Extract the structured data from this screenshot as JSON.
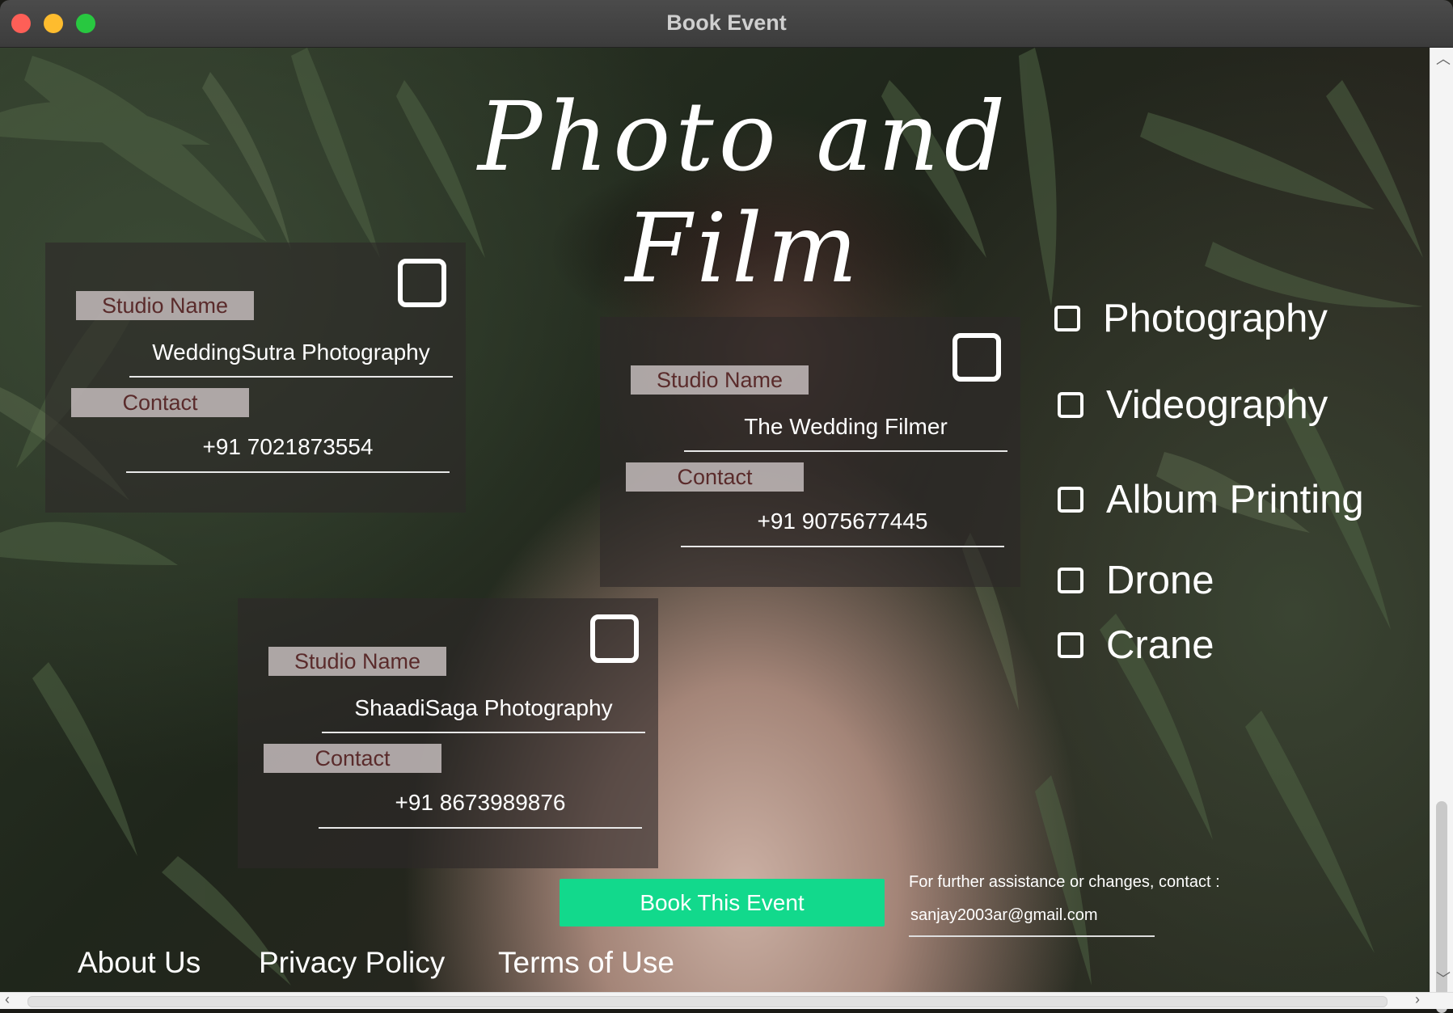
{
  "window": {
    "title": "Book Event"
  },
  "hero": {
    "title": "Photo and Film"
  },
  "studios": [
    {
      "studio_label": "Studio Name",
      "studio_name": "WeddingSutra Photography",
      "contact_label": "Contact",
      "contact": "+91  7021873554",
      "selected": false
    },
    {
      "studio_label": "Studio Name",
      "studio_name": "The Wedding Filmer",
      "contact_label": "Contact",
      "contact": "+91  9075677445",
      "selected": false
    },
    {
      "studio_label": "Studio Name",
      "studio_name": "ShaadiSaga Photography",
      "contact_label": "Contact",
      "contact": "+91 8673989876",
      "selected": false
    }
  ],
  "services": [
    {
      "label": "Photography",
      "checked": false
    },
    {
      "label": "Videography",
      "checked": false
    },
    {
      "label": "Album Printing",
      "checked": false
    },
    {
      "label": "Drone",
      "checked": false
    },
    {
      "label": "Crane",
      "checked": false
    }
  ],
  "actions": {
    "book_label": "Book This Event"
  },
  "assistance": {
    "text": "For further assistance or changes, contact :",
    "email": "sanjay2003ar@gmail.com"
  },
  "footer": {
    "about": "About Us",
    "privacy": "Privacy Policy",
    "terms": "Terms of Use"
  },
  "colors": {
    "accent": "#12d98c",
    "chip": "#c4bcbc",
    "chip_text": "#5a2b2b"
  }
}
